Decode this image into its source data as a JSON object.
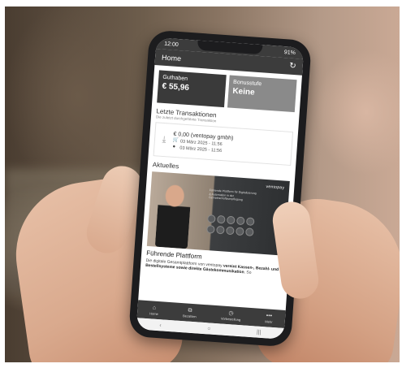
{
  "status": {
    "time": "12:00",
    "battery": "91%"
  },
  "appbar": {
    "title": "Home",
    "refresh_icon": "refresh-icon"
  },
  "cards": [
    {
      "label": "Guthaben",
      "value": "€ 55,96"
    },
    {
      "label": "Bonusstufe",
      "value": "Keine"
    }
  ],
  "transactions": {
    "title": "Letzte Transaktionen",
    "subtitle": "Die zuletzt durchgeführte Transaktion",
    "item": {
      "title": "€ 0,00 (ventopay gmbh)",
      "line1": "03 März 2025 - 11:56",
      "line2": "03 März 2025 - 11:56"
    }
  },
  "news": {
    "section_title": "Aktuelles",
    "brand": "ventopay",
    "image_text": "Führende Plattform für Digitalisierung & Automation in der Gemeinschaftsverpflegung",
    "headline": "Führende Plattform",
    "body_start": "Die digitale Gesamtplattform von ventopay ",
    "body_bold": "vereint Kassen-, Bezahl- und Bestellsysteme sowie direkte Gästekommunikation",
    "body_end": ". So"
  },
  "nav": [
    {
      "label": "Home",
      "icon": "home-icon"
    },
    {
      "label": "Bezahlen",
      "icon": "pay-icon"
    },
    {
      "label": "Vorbestellung",
      "icon": "clock-icon"
    },
    {
      "label": "Mehr",
      "icon": "more-icon"
    }
  ],
  "sysnav": {
    "back": "‹",
    "home": "○",
    "recent": "|||"
  }
}
